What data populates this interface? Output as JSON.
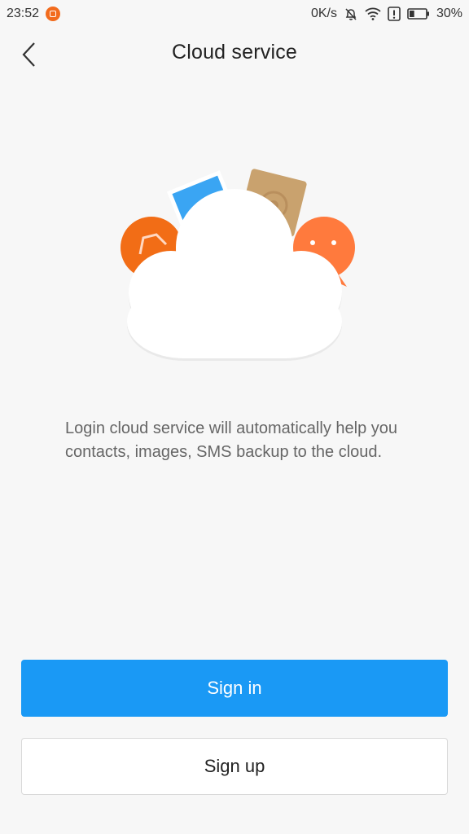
{
  "status_bar": {
    "time": "23:52",
    "network_speed": "0K/s",
    "battery_percent": "30%",
    "battery_level": 0.3,
    "icons": [
      "app-notification-icon",
      "mute-bell-icon",
      "wifi-icon",
      "alert-icon",
      "battery-icon"
    ]
  },
  "header": {
    "back_icon": "chevron-left-icon",
    "title": "Cloud service"
  },
  "illustration": {
    "icons": [
      "cloud-icon",
      "contacts-icon",
      "image-icon",
      "photo-card-icon",
      "message-icon"
    ],
    "colors": {
      "orange": "#f26d16",
      "orange_light": "#ff7a3d",
      "blue": "#3aa5f3",
      "tan": "#c9a26e",
      "cloud": "#ffffff"
    }
  },
  "description": "Login cloud service will automatically help you contacts, images, SMS backup to the cloud.",
  "buttons": {
    "sign_in": "Sign in",
    "sign_up": "Sign up"
  },
  "colors": {
    "accent": "#1a99f5",
    "background": "#f7f7f7"
  }
}
